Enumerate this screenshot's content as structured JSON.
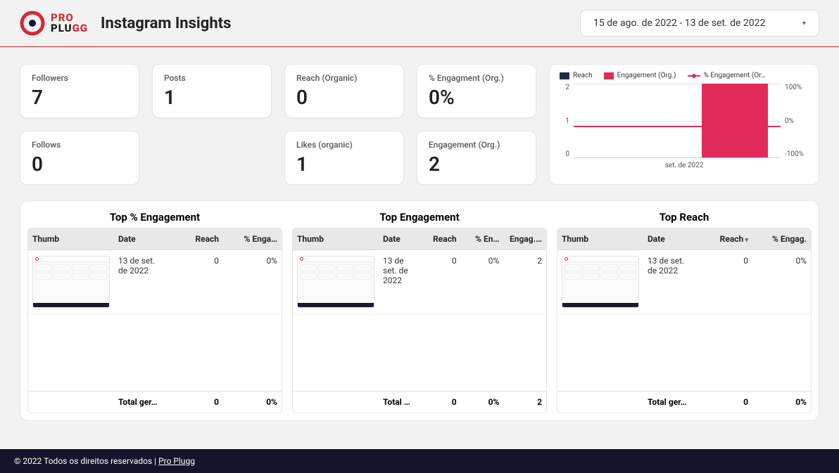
{
  "logo": {
    "line1": "PRO",
    "line2_a": "PLU",
    "line2_b": "GG"
  },
  "page_title": "Instagram Insights",
  "date_range": "15 de ago. de 2022 - 13 de set. de 2022",
  "metrics": {
    "followers": {
      "label": "Followers",
      "value": "7"
    },
    "posts": {
      "label": "Posts",
      "value": "1"
    },
    "reach_organic": {
      "label": "Reach (Organic)",
      "value": "0"
    },
    "engagement_pct_org": {
      "label": "% Engagment (Org.)",
      "value": "0%"
    },
    "follows": {
      "label": "Follows",
      "value": "0"
    },
    "likes_organic": {
      "label": "Likes (organic)",
      "value": "1"
    },
    "engagement_org": {
      "label": "Engagement (Org.)",
      "value": "2"
    }
  },
  "chart": {
    "legend": {
      "reach": "Reach",
      "eng": "Engagement (Org.)",
      "eng_pct": "% Engagement (Or…"
    },
    "y_left": [
      "2",
      "1",
      "0"
    ],
    "y_right": [
      "100%",
      "0%",
      "-100%"
    ],
    "x_label": "set. de 2022"
  },
  "chart_data": {
    "type": "bar",
    "x": [
      "set. de 2022"
    ],
    "y_left_axis": {
      "label": "",
      "range": [
        0,
        2
      ]
    },
    "y_right_axis": {
      "label": "",
      "range": [
        -100,
        100
      ],
      "unit": "%"
    },
    "series": [
      {
        "name": "Reach",
        "axis": "left",
        "type": "bar",
        "color": "#1a2b4a",
        "values": [
          0
        ]
      },
      {
        "name": "Engagement (Org.)",
        "axis": "left",
        "type": "bar",
        "color": "#e12a5a",
        "values": [
          2
        ]
      },
      {
        "name": "% Engagement (Org.)",
        "axis": "right",
        "type": "line",
        "color": "#e12a5a",
        "values": [
          0
        ]
      }
    ]
  },
  "tables": {
    "top_pct_engagement": {
      "title": "Top % Engagement",
      "headers": [
        "Thumb",
        "Date",
        "Reach",
        "% Enga…"
      ],
      "rows": [
        {
          "date": "13 de set. de 2022",
          "reach": "0",
          "pct": "0%"
        }
      ],
      "footer": {
        "label": "Total ger…",
        "reach": "0",
        "pct": "0%"
      }
    },
    "top_engagement": {
      "title": "Top Engagement",
      "headers": [
        "Thumb",
        "Date",
        "Reach",
        "% En…",
        "Engag.…"
      ],
      "rows": [
        {
          "date": "13 de set. de 2022",
          "reach": "0",
          "pct": "0%",
          "eng": "2"
        }
      ],
      "footer": {
        "label": "Total …",
        "reach": "0",
        "pct": "0%",
        "eng": "2"
      }
    },
    "top_reach": {
      "title": "Top Reach",
      "headers": [
        "Thumb",
        "Date",
        "Reach",
        "% Engag."
      ],
      "rows": [
        {
          "date": "13 de set. de 2022",
          "reach": "0",
          "pct": "0%"
        }
      ],
      "footer": {
        "label": "Total ger…",
        "reach": "0",
        "pct": "0%"
      }
    }
  },
  "footer": {
    "copyright": "© 2022 Todos os direitos reservados | ",
    "link": "Pro Plugg"
  }
}
